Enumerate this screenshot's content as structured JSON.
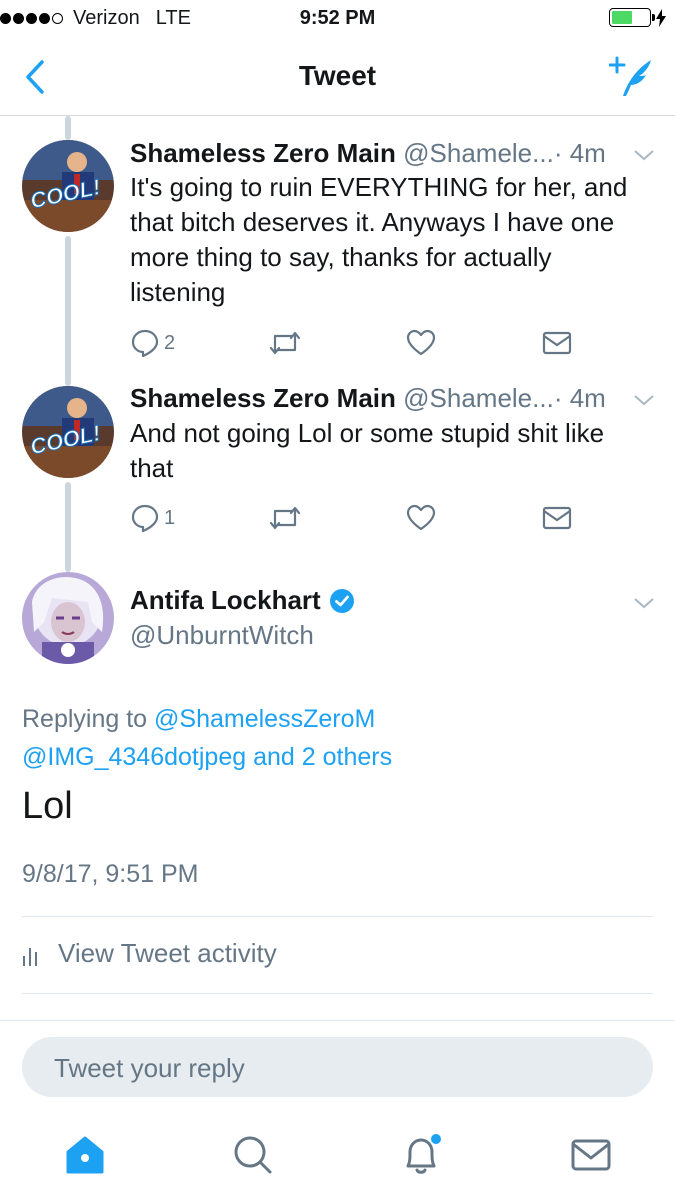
{
  "status_bar": {
    "carrier": "Verizon",
    "network": "LTE",
    "time": "9:52 PM"
  },
  "nav": {
    "title": "Tweet"
  },
  "thread": [
    {
      "name": "Shameless Zero Main",
      "handle": "@Shamele...",
      "time": "· 4m",
      "text": "It's going to ruin EVERYTHING for her, and that bitch deserves it. Anyways I have one more thing to say, thanks for actually listening",
      "reply_count": "2",
      "avatar_text": "COOL!"
    },
    {
      "name": "Shameless Zero Main",
      "handle": "@Shamele...",
      "time": "· 4m",
      "text": "And not going Lol or some stupid shit like that",
      "reply_count": "1",
      "avatar_text": "COOL!"
    }
  ],
  "main_tweet": {
    "name": "Antifa Lockhart",
    "handle": "@UnburntWitch",
    "replying_prefix": "Replying to",
    "replying_user1": "@ShamelessZeroM",
    "replying_user2": "@IMG_4346dotjpeg",
    "replying_and": "and",
    "replying_others": "2 others",
    "text": "Lol",
    "timestamp": "9/8/17, 9:51 PM",
    "activity_label": "View Tweet activity"
  },
  "reply": {
    "placeholder": "Tweet your reply"
  },
  "tabs": [
    "home-icon",
    "search-icon",
    "notifications-icon",
    "messages-icon"
  ],
  "colors": {
    "accent": "#1da1f2",
    "secondary_text": "#657786",
    "thread_line": "#ccd6dd"
  }
}
